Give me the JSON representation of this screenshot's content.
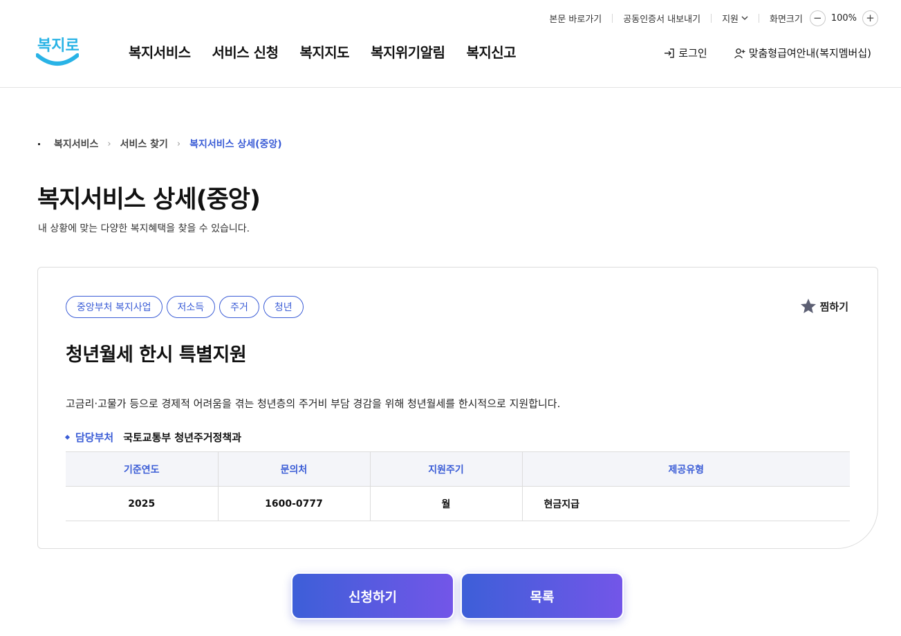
{
  "utility": {
    "skip_link": "본문 바로가기",
    "cert_export": "공동인증서 내보내기",
    "language": "지원",
    "zoom_label": "화면크기",
    "zoom_value": "100%",
    "zoom_minus": "−",
    "zoom_plus": "+"
  },
  "header": {
    "logo_text": "복지로",
    "nav": [
      "복지서비스",
      "서비스 신청",
      "복지지도",
      "복지위기알림",
      "복지신고"
    ],
    "login": "로그인",
    "membership": "맞춤형급여안내(복지멤버십)"
  },
  "breadcrumb": [
    "복지서비스",
    "서비스 찾기",
    "복지서비스 상세(중앙)"
  ],
  "page": {
    "title": "복지서비스 상세(중앙)",
    "description": "내 상황에 맞는 다양한 복지혜택을 찾을 수 있습니다."
  },
  "service": {
    "tags": [
      "중앙부처 복지사업",
      "저소득",
      "주거",
      "청년"
    ],
    "favorite": "찜하기",
    "title": "청년월세 한시 특별지원",
    "description": "고금리·고물가 등으로 경제적 어려움을 겪는 청년층의 주거비 부담 경감을 위해 청년월세를 한시적으로 지원합니다.",
    "dept_label": "담당부처",
    "dept_value": "국토교통부 청년주거정책과",
    "table": {
      "headers": [
        "기준연도",
        "문의처",
        "지원주기",
        "제공유형"
      ],
      "row": [
        "2025",
        "1600-0777",
        "월",
        "현금지급"
      ]
    }
  },
  "buttons": {
    "apply": "신청하기",
    "list": "목록"
  },
  "colors": {
    "accent": "#3a5cd6",
    "logo": "#29b3e6",
    "button_gradient_start": "#3d5fd8",
    "button_gradient_end": "#7356e8"
  }
}
